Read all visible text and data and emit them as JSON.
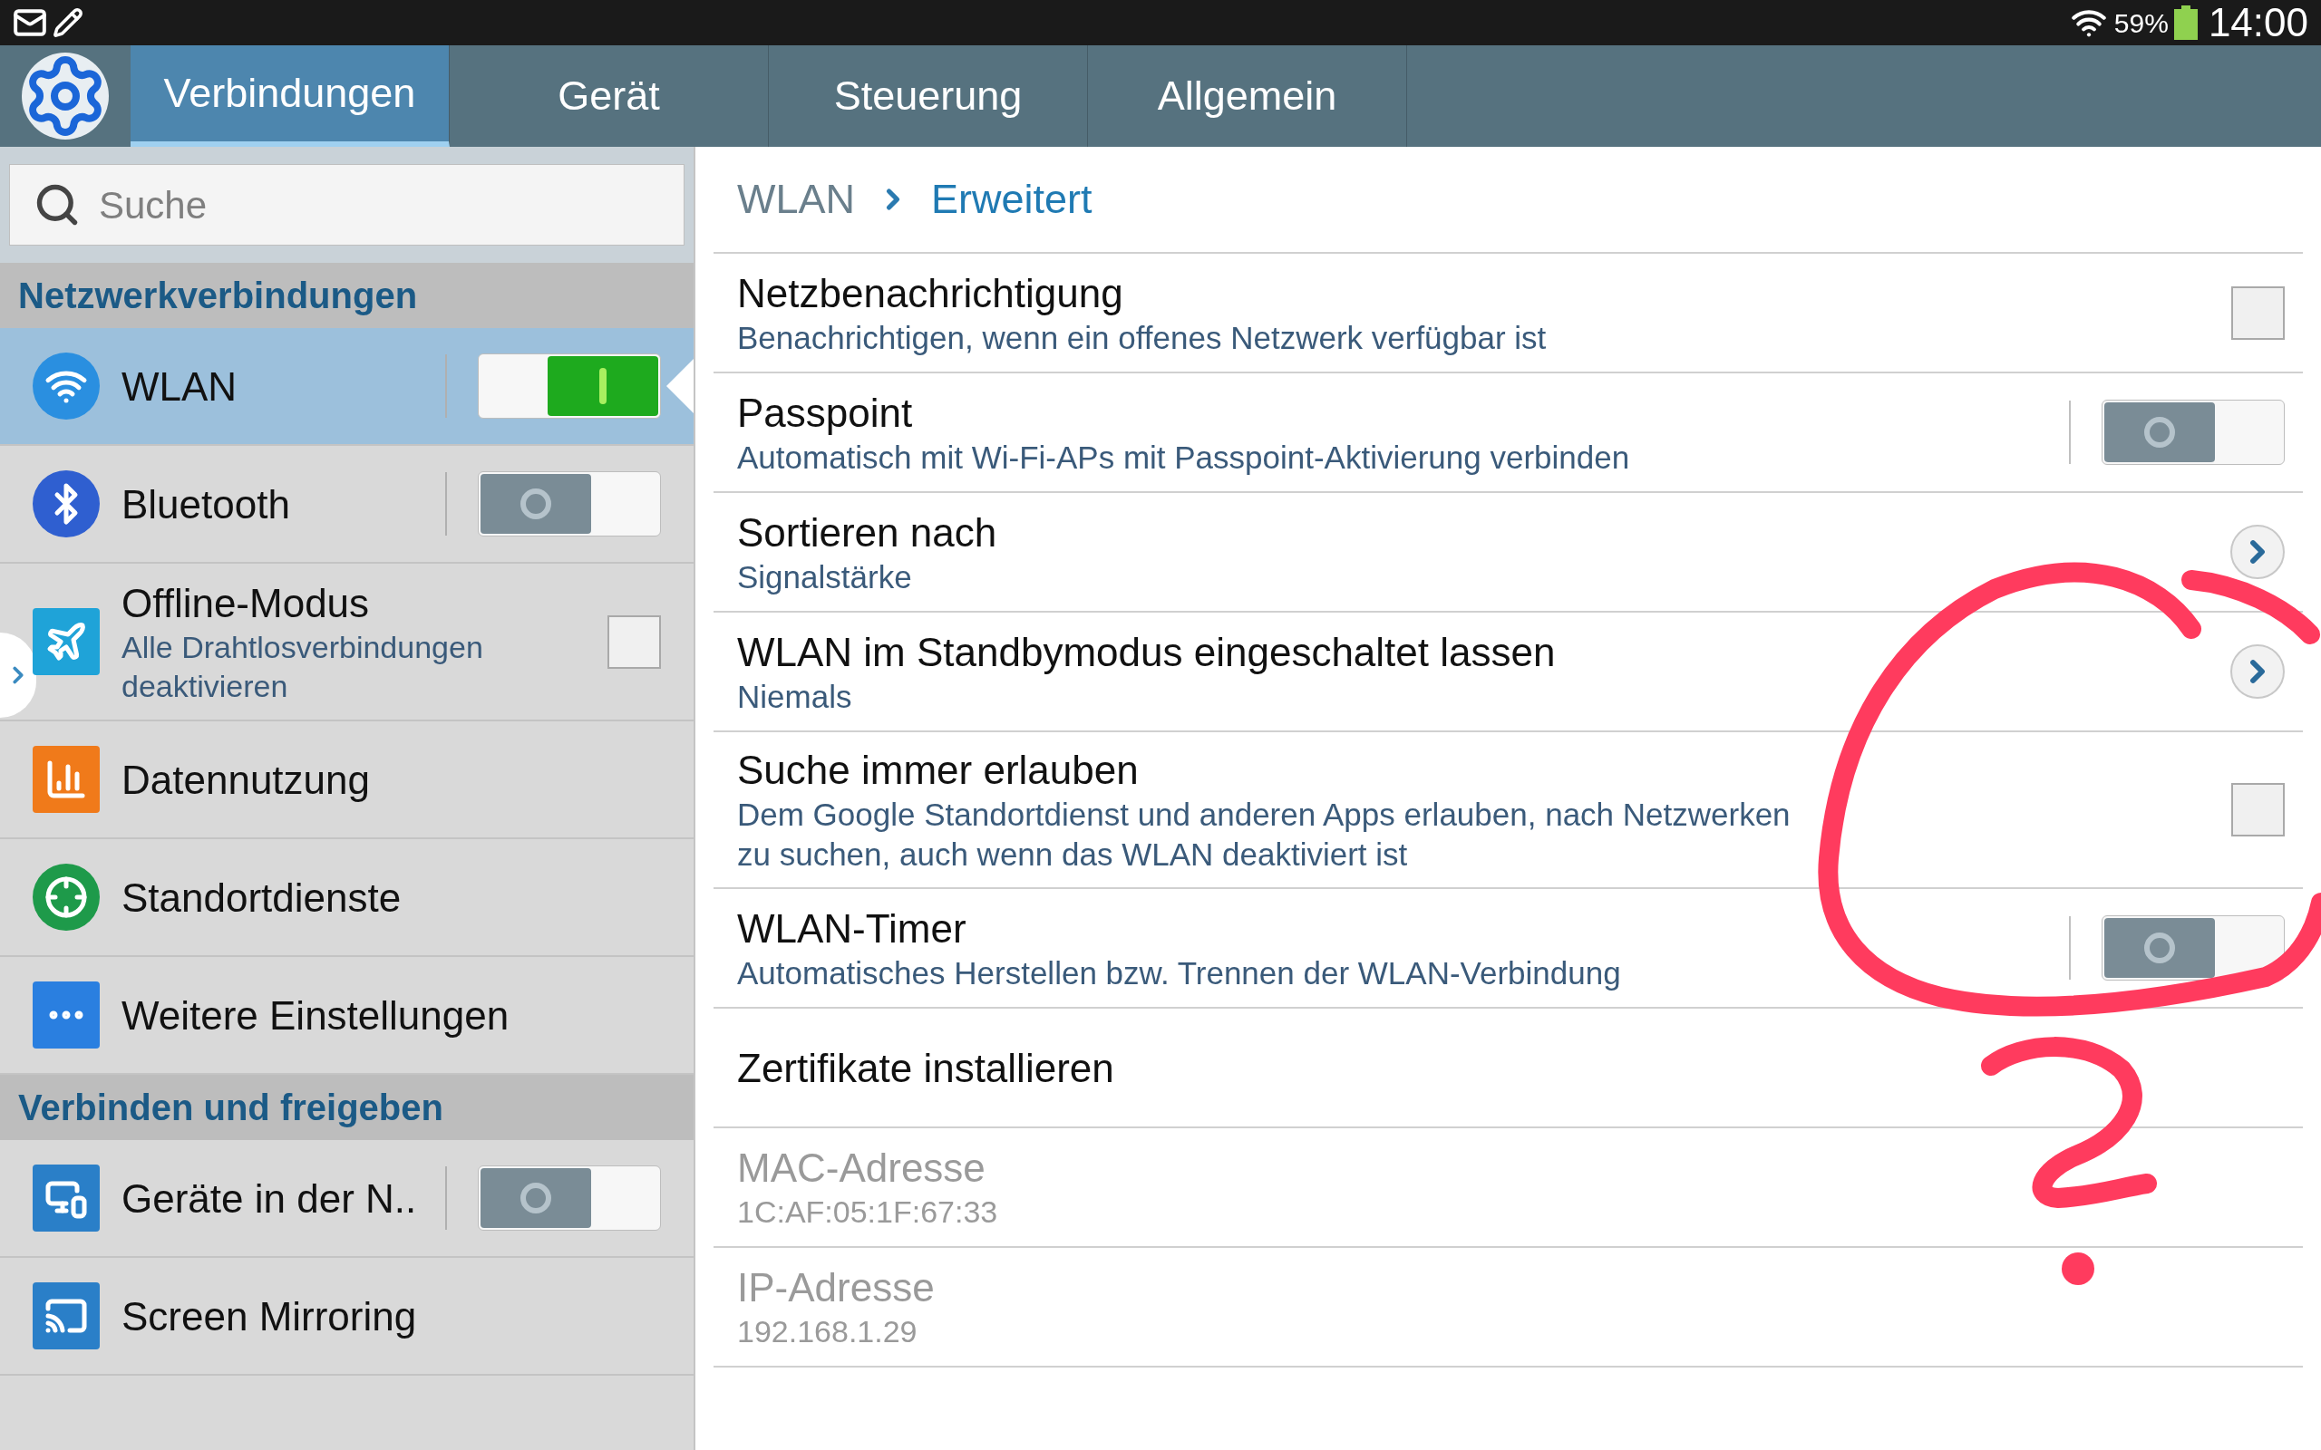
{
  "status_bar": {
    "battery": "59%",
    "time": "14:00"
  },
  "tabs": [
    {
      "label": "Verbindungen",
      "selected": true
    },
    {
      "label": "Gerät",
      "selected": false
    },
    {
      "label": "Steuerung",
      "selected": false
    },
    {
      "label": "Allgemein",
      "selected": false
    }
  ],
  "search": {
    "placeholder": "Suche"
  },
  "sidebar": [
    {
      "header": "Netzwerkverbindungen",
      "items": [
        {
          "title": "WLAN",
          "kind": "toggle",
          "on": true,
          "selected": true
        },
        {
          "title": "Bluetooth",
          "kind": "toggle",
          "on": false,
          "selected": false
        },
        {
          "title": "Offline-Modus",
          "subtitle": "Alle Drahtlosverbindungen deaktivieren",
          "kind": "checkbox",
          "checked": false,
          "selected": false
        },
        {
          "title": "Datennutzung",
          "kind": "link",
          "selected": false
        },
        {
          "title": "Standortdienste",
          "kind": "link",
          "selected": false
        },
        {
          "title": "Weitere Einstellungen",
          "kind": "link",
          "selected": false
        }
      ]
    },
    {
      "header": "Verbinden und freigeben",
      "items": [
        {
          "title": "Geräte in der N..",
          "kind": "toggle",
          "on": false,
          "selected": false
        },
        {
          "title": "Screen Mirroring",
          "kind": "link",
          "selected": false
        }
      ]
    }
  ],
  "breadcrumb": [
    "WLAN",
    "Erweitert"
  ],
  "settings": [
    {
      "title": "Netzbenachrichtigung",
      "subtitle": "Benachrichtigen, wenn ein offenes Netzwerk verfügbar ist",
      "kind": "checkbox",
      "checked": false
    },
    {
      "title": "Passpoint",
      "subtitle": "Automatisch mit Wi-Fi-APs mit Passpoint-Aktivierung verbinden",
      "kind": "toggle",
      "on": false
    },
    {
      "title": "Sortieren nach",
      "subtitle": "Signalstärke",
      "kind": "link"
    },
    {
      "title": "WLAN im Standbymodus eingeschaltet lassen",
      "subtitle": "Niemals",
      "kind": "link"
    },
    {
      "title": "Suche immer erlauben",
      "subtitle": "Dem Google Standortdienst und anderen Apps erlauben, nach Netzwerken zu suchen, auch wenn das WLAN deaktiviert ist",
      "kind": "checkbox",
      "checked": false
    },
    {
      "title": "WLAN-Timer",
      "subtitle": "Automatisches Herstellen bzw. Trennen der WLAN-Verbindung",
      "kind": "toggle",
      "on": false
    },
    {
      "title": "Zertifikate installieren",
      "kind": "plain"
    },
    {
      "title": "MAC-Adresse",
      "subtitle": "1C:AF:05:1F:67:33",
      "kind": "info"
    },
    {
      "title": "IP-Adresse",
      "subtitle": "192.168.1.29",
      "kind": "info"
    }
  ]
}
